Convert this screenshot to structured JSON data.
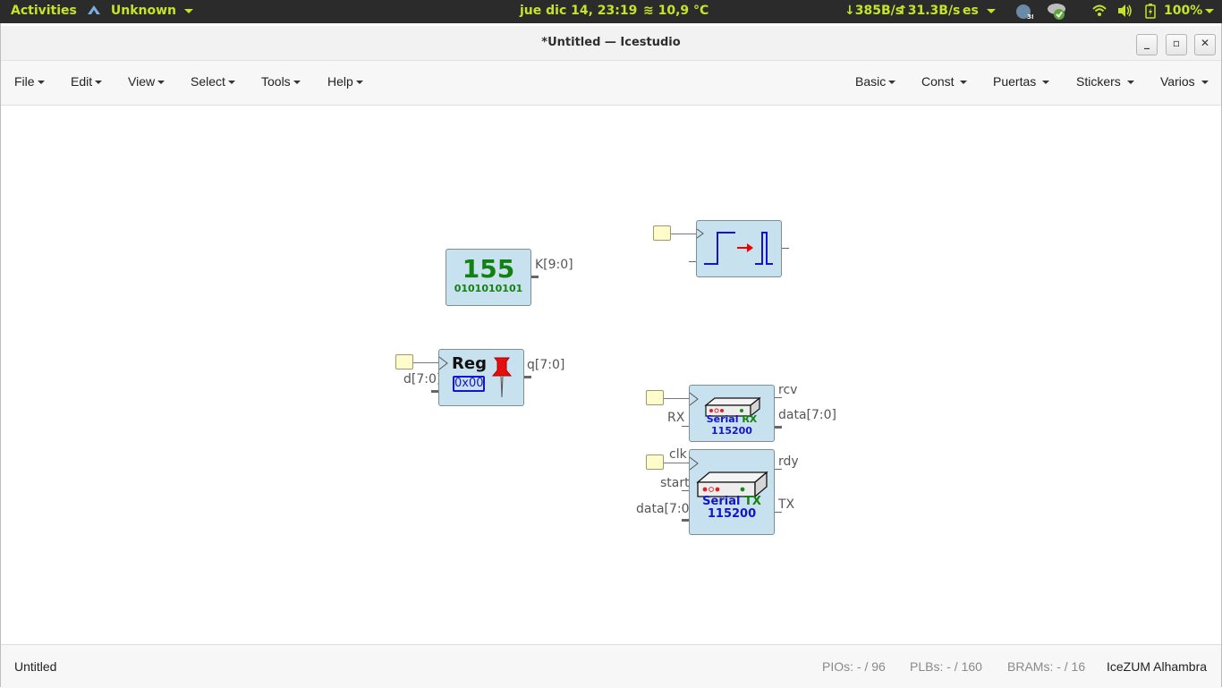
{
  "topbar": {
    "activities": "Activities",
    "app_menu": "Unknown",
    "clock": "jue dic 14, 23:19",
    "weather": "10,9 °C",
    "net_down": "↓385B/s",
    "net_up": "↑31.3B/s",
    "keyboard": "es",
    "badge": "38",
    "battery": "100%"
  },
  "window": {
    "title": "*Untitled — Icestudio",
    "minimize": "_",
    "maximize": "▫",
    "close": "✕"
  },
  "menubar": {
    "left": [
      "File",
      "Edit",
      "View",
      "Select",
      "Tools",
      "Help"
    ],
    "right": [
      "Basic",
      "Const",
      "Puertas",
      "Stickers",
      "Varios"
    ]
  },
  "blocks": {
    "constant": {
      "value": "155",
      "binary": "0101010101",
      "out_label": "K[9:0]"
    },
    "register": {
      "title": "Reg",
      "init": "0x00",
      "in_label": "d[7:0]",
      "out_label": "q[7:0]"
    },
    "serial_rx": {
      "title_a": "Serial",
      "title_b": "RX",
      "baud": "115200",
      "in_label": "RX",
      "out_rcv": "rcv",
      "out_data": "data[7:0]"
    },
    "serial_tx": {
      "title_a": "Serial",
      "title_b": "TX",
      "baud": "115200",
      "in_clk": "clk",
      "in_start": "start",
      "in_data": "data[7:0]",
      "out_rdy": "rdy",
      "out_tx": "TX"
    }
  },
  "statusbar": {
    "file": "Untitled",
    "pios": "PIOs:  - / 96",
    "plbs": "PLBs:  - / 160",
    "brams": "BRAMs:  - / 16",
    "board": "IceZUM Alhambra"
  },
  "colors": {
    "topbar_bg": "#2b2b2b",
    "topbar_fg": "#c4e42a",
    "block_bg": "#c8e1ef",
    "const_green": "#128112",
    "serial_blue": "#1414c8"
  }
}
